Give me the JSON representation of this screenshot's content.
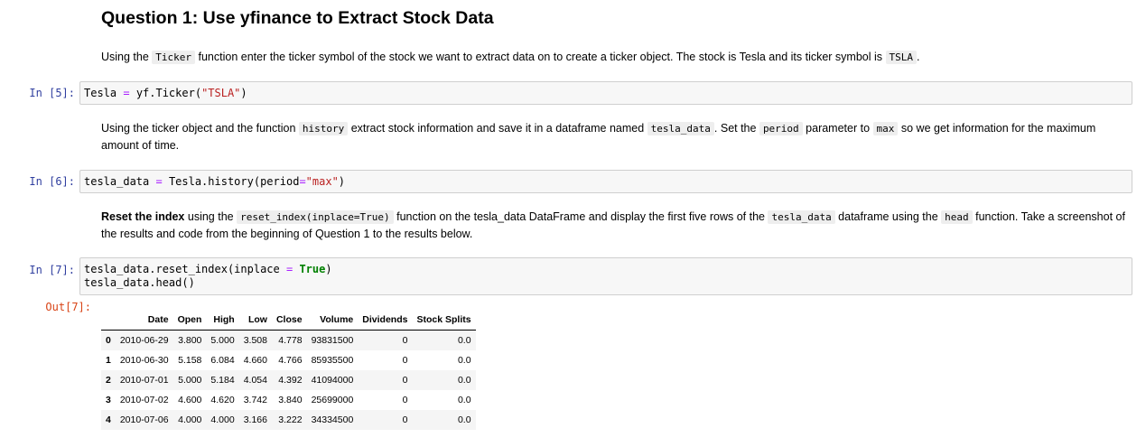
{
  "heading": "Question 1: Use yfinance to Extract Stock Data",
  "p1": {
    "t1": "Using the ",
    "c1": "Ticker",
    "t2": " function enter the ticker symbol of the stock we want to extract data on to create a ticker object. The stock is Tesla and its ticker symbol is ",
    "c2": "TSLA",
    "t3": "."
  },
  "cell5": {
    "prompt": "In [5]:",
    "a": "Tesla",
    "op": " = ",
    "b": "yf.Ticker(",
    "str": "\"TSLA\"",
    "c": ")"
  },
  "p2": {
    "t1": "Using the ticker object and the function ",
    "c1": "history",
    "t2": " extract stock information and save it in a dataframe named ",
    "c2": "tesla_data",
    "t3": ". Set the ",
    "c3": "period",
    "t4": " parameter to ",
    "c4": "max",
    "t5": " so we get information for the maximum amount of time."
  },
  "cell6": {
    "prompt": "In [6]:",
    "a": "tesla_data",
    "op": " = ",
    "b": "Tesla.history(period",
    "op2": "=",
    "str": "\"max\"",
    "c": ")"
  },
  "p3": {
    "bold": "Reset the index",
    "t1": " using the ",
    "c1": "reset_index(inplace=True)",
    "t2": " function on the tesla_data DataFrame and display the first five rows of the ",
    "c2": "tesla_data",
    "t3": " dataframe using the ",
    "c3": "head",
    "t4": " function. Take a screenshot of the results and code from the beginning of Question 1 to the results below."
  },
  "cell7": {
    "prompt": "In [7]:",
    "l1a": "tesla_data.reset_index(inplace",
    "l1op": " = ",
    "l1kw": "True",
    "l1b": ")",
    "l2": "tesla_data.head()"
  },
  "out7": {
    "prompt": "Out[7]:",
    "columns": [
      "",
      "Date",
      "Open",
      "High",
      "Low",
      "Close",
      "Volume",
      "Dividends",
      "Stock Splits"
    ],
    "rows": [
      [
        "0",
        "2010-06-29",
        "3.800",
        "5.000",
        "3.508",
        "4.778",
        "93831500",
        "0",
        "0.0"
      ],
      [
        "1",
        "2010-06-30",
        "5.158",
        "6.084",
        "4.660",
        "4.766",
        "85935500",
        "0",
        "0.0"
      ],
      [
        "2",
        "2010-07-01",
        "5.000",
        "5.184",
        "4.054",
        "4.392",
        "41094000",
        "0",
        "0.0"
      ],
      [
        "3",
        "2010-07-02",
        "4.600",
        "4.620",
        "3.742",
        "3.840",
        "25699000",
        "0",
        "0.0"
      ],
      [
        "4",
        "2010-07-06",
        "4.000",
        "4.000",
        "3.166",
        "3.222",
        "34334500",
        "0",
        "0.0"
      ]
    ]
  }
}
